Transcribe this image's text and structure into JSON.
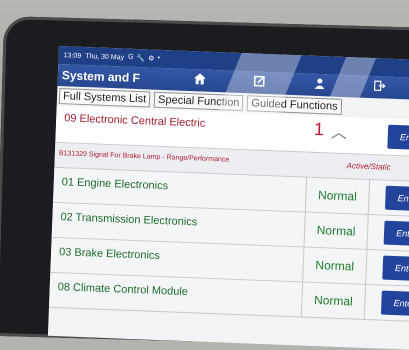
{
  "status_bar": {
    "time": "13:09",
    "date": "Thu, 30 May",
    "icons": [
      "G",
      "🔧",
      "⚙",
      "•"
    ]
  },
  "header": {
    "title": "System and F",
    "icons": [
      "home-icon",
      "edit-icon",
      "user-icon",
      "exit-icon"
    ]
  },
  "tabs": [
    {
      "label": "Full Systems List"
    },
    {
      "label": "Special Function"
    },
    {
      "label": "Guided Functions"
    }
  ],
  "systems": [
    {
      "code": "09",
      "name": "09 Electronic Central Electric",
      "fault_count": "1",
      "enter_label": "Enter"
    },
    {
      "code": "01",
      "name": "01 Engine Electronics",
      "status": "Normal",
      "enter_label": "Enter"
    },
    {
      "code": "02",
      "name": "02 Transmission Electronics",
      "status": "Normal",
      "enter_label": "Enter"
    },
    {
      "code": "03",
      "name": "03 Brake Electronics",
      "status": "Normal",
      "enter_label": "Enter"
    },
    {
      "code": "08",
      "name": "08 Climate Control Module",
      "status": "Normal",
      "enter_label": "Enter"
    }
  ],
  "fault": {
    "text": "B131329 Signal For Brake Lamp - Range/Performance",
    "status": "Active/Static"
  },
  "colors": {
    "header": "#27478f",
    "fault_red": "#c3192f",
    "normal_green": "#1d7a2c"
  }
}
